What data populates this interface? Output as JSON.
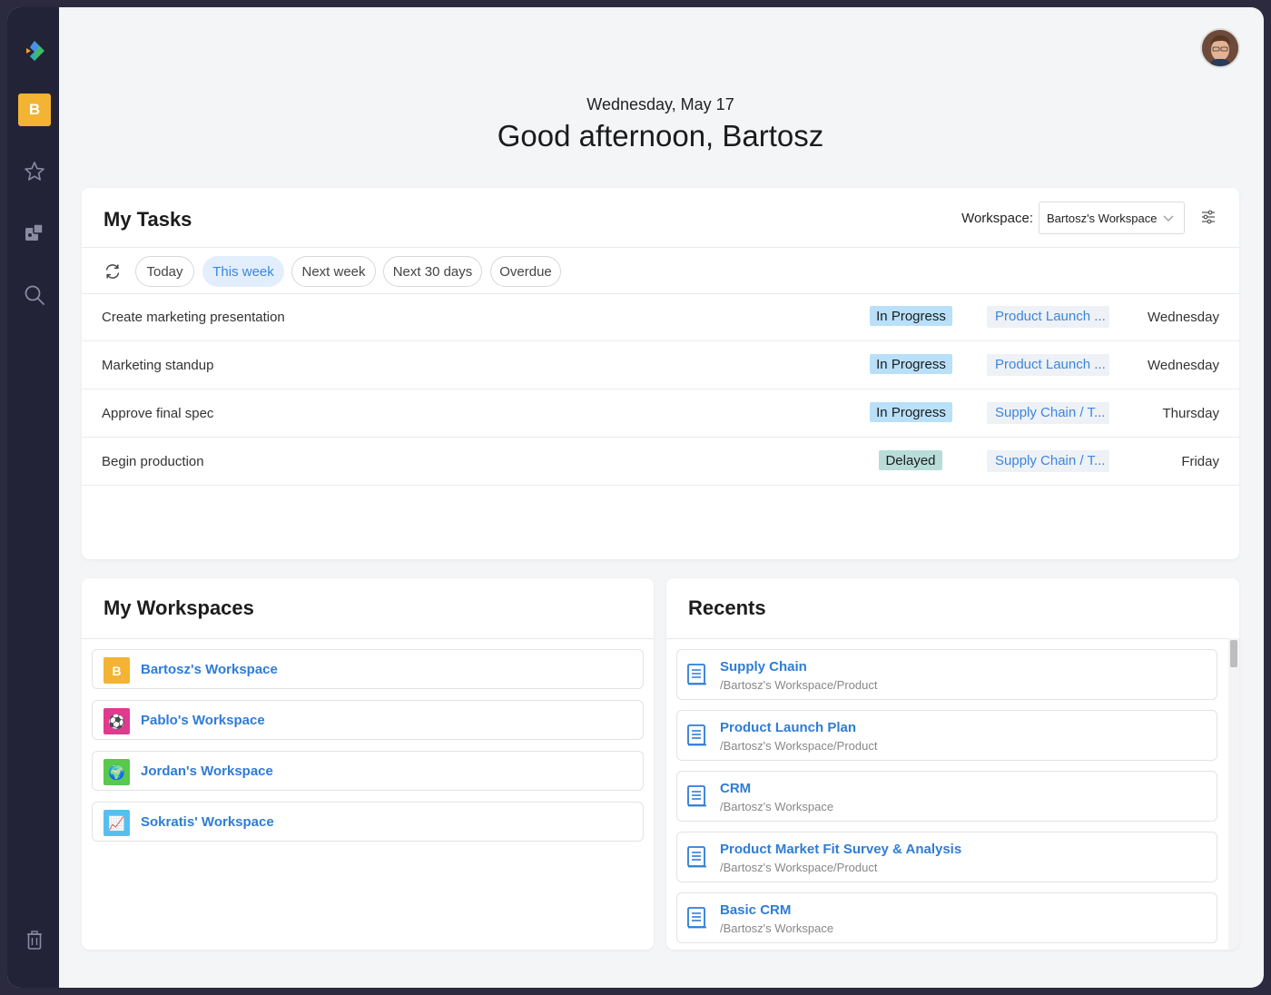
{
  "sidebar": {
    "workspace_initial": "B",
    "icons": [
      "app-logo",
      "star-icon",
      "templates-icon",
      "search-icon",
      "trash-icon"
    ]
  },
  "header": {
    "date": "Wednesday, May 17",
    "greeting": "Good afternoon, Bartosz"
  },
  "tasks": {
    "title": "My Tasks",
    "workspace_label": "Workspace:",
    "workspace_value": "Bartosz's Workspace",
    "filters": [
      {
        "label": "Today",
        "active": false
      },
      {
        "label": "This week",
        "active": true
      },
      {
        "label": "Next week",
        "active": false
      },
      {
        "label": "Next 30 days",
        "active": false
      },
      {
        "label": "Overdue",
        "active": false
      }
    ],
    "rows": [
      {
        "name": "Create marketing presentation",
        "status": "In Progress",
        "project": "Product Launch ...",
        "due": "Wednesday"
      },
      {
        "name": "Marketing standup",
        "status": "In Progress",
        "project": "Product Launch ...",
        "due": "Wednesday"
      },
      {
        "name": "Approve final spec",
        "status": "In Progress",
        "project": "Supply Chain / T...",
        "due": "Thursday"
      },
      {
        "name": "Begin production",
        "status": "Delayed",
        "project": "Supply Chain / T...",
        "due": "Friday"
      }
    ]
  },
  "workspaces": {
    "title": "My Workspaces",
    "items": [
      {
        "name": "Bartosz's Workspace",
        "badge": "B",
        "color": "#f3b333"
      },
      {
        "name": "Pablo's Workspace",
        "badge": "⚽",
        "color": "#e2398f"
      },
      {
        "name": "Jordan's Workspace",
        "badge": "🌍",
        "color": "#58c94a"
      },
      {
        "name": "Sokratis' Workspace",
        "badge": "📈",
        "color": "#56bff0"
      }
    ]
  },
  "recents": {
    "title": "Recents",
    "items": [
      {
        "title": "Supply Chain",
        "path": "/Bartosz's Workspace/Product"
      },
      {
        "title": "Product Launch Plan",
        "path": "/Bartosz's Workspace/Product"
      },
      {
        "title": "CRM",
        "path": "/Bartosz's Workspace"
      },
      {
        "title": "Product Market Fit Survey & Analysis",
        "path": "/Bartosz's Workspace/Product"
      },
      {
        "title": "Basic CRM",
        "path": "/Bartosz's Workspace"
      }
    ]
  },
  "colors": {
    "sidebar_bg": "#232337",
    "accent_blue": "#2f7cd6",
    "in_progress": "#b9e0f8",
    "delayed": "#b8ddd8",
    "workspace_yellow": "#f3b333"
  }
}
